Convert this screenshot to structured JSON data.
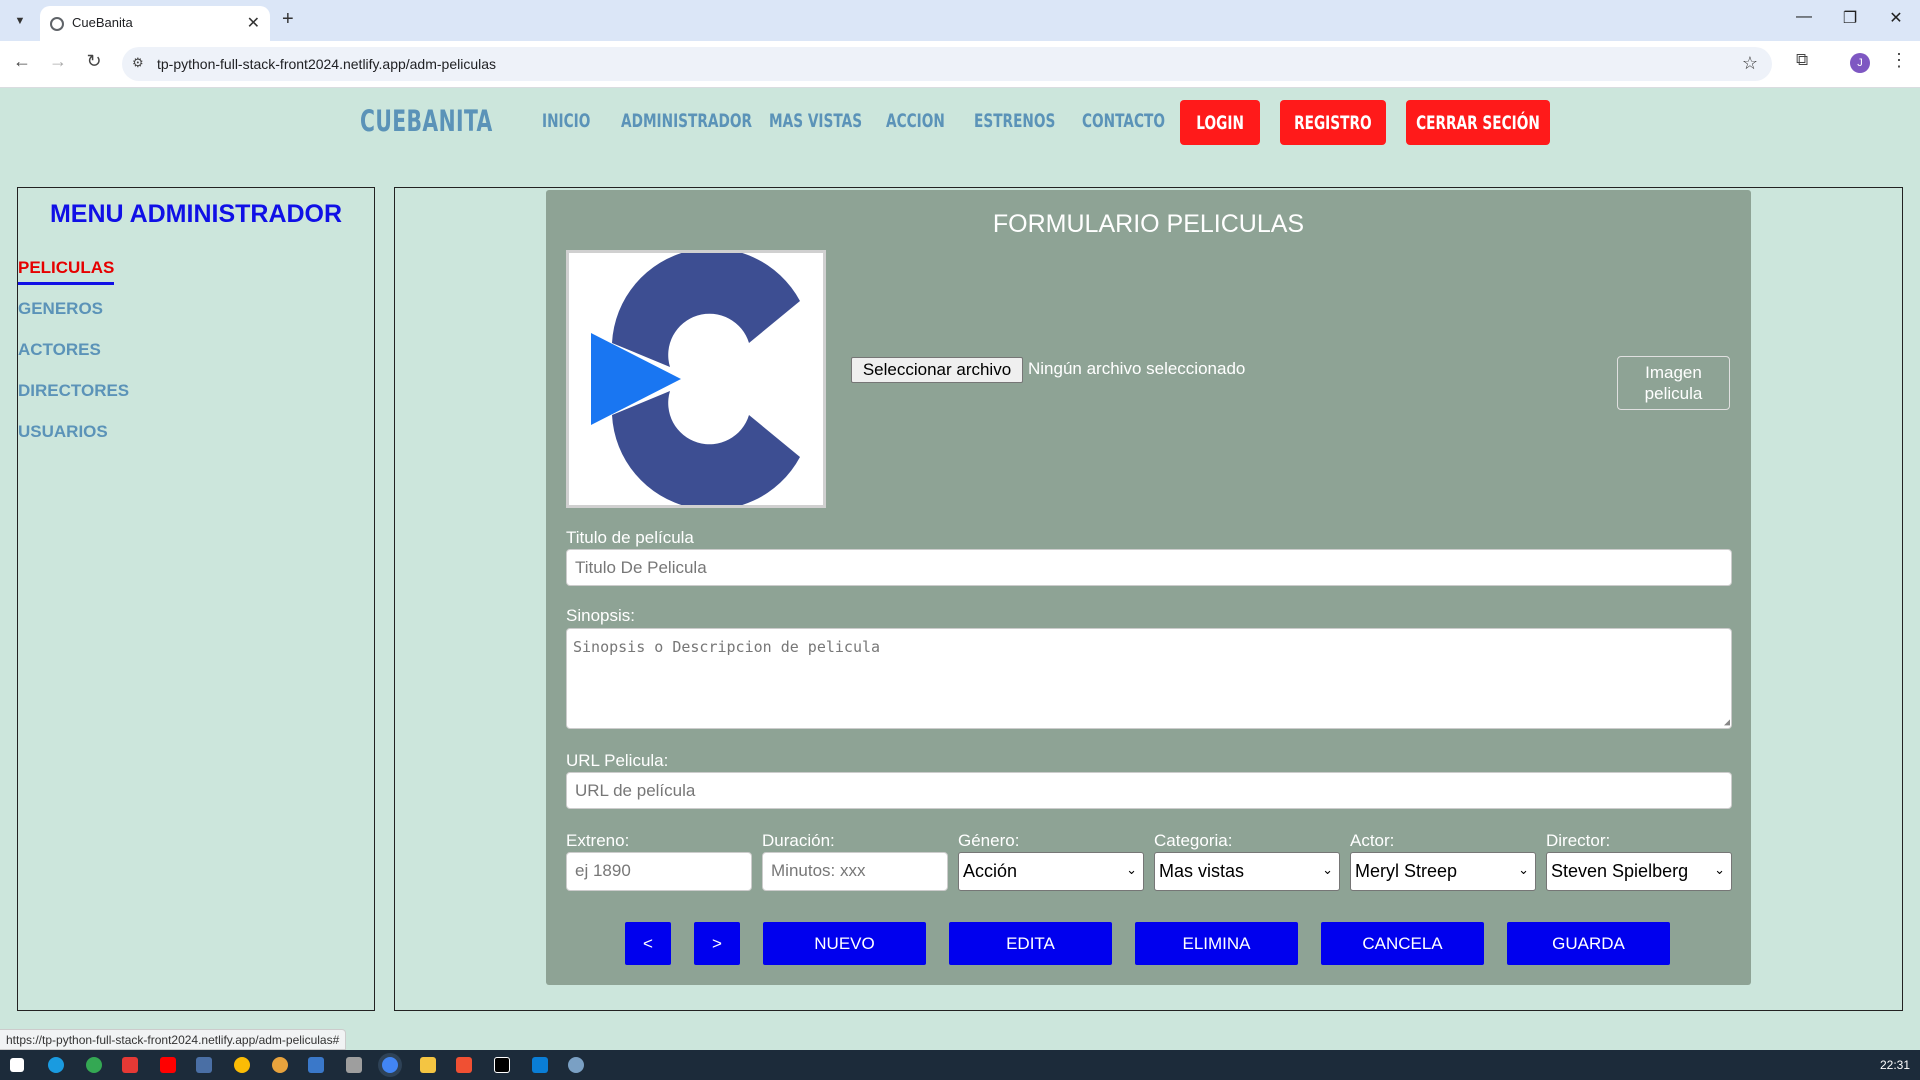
{
  "browser": {
    "tab_title": "CueBanita",
    "url": "tp-python-full-stack-front2024.netlify.app/adm-peliculas",
    "profile_initial": "J",
    "status_url": "https://tp-python-full-stack-front2024.netlify.app/adm-peliculas#"
  },
  "site": {
    "logo": "CUEBANITA",
    "nav": [
      "INICIO",
      "ADMINISTRADOR",
      "MAS VISTAS",
      "ACCION",
      "ESTRENOS",
      "CONTACTO"
    ],
    "buttons": {
      "login": "LOGIN",
      "registro": "REGISTRO",
      "logout": "CERRAR SECIÓN"
    }
  },
  "sidebar": {
    "title": "MENU ADMINISTRADOR",
    "items": [
      "PELICULAS",
      "GENEROS",
      "ACTORES",
      "DIRECTORES",
      "USUARIOS"
    ],
    "active": "PELICULAS"
  },
  "form": {
    "title": "FORMULARIO PELICULAS",
    "file_button": "Seleccionar archivo",
    "file_status": "Ningún archivo seleccionado",
    "image_label": "Imagen pelicula",
    "title_label": "Titulo de película",
    "title_placeholder": "Titulo De Pelicula",
    "synopsis_label": "Sinopsis:",
    "synopsis_placeholder": "Sinopsis o Descripcion de pelicula",
    "url_label": "URL Pelicula:",
    "url_placeholder": "URL de película",
    "release_label": "Extreno:",
    "release_placeholder": "ej 1890",
    "duration_label": "Duración:",
    "duration_placeholder": "Minutos: xxx",
    "genre_label": "Género:",
    "genre_value": "Acción",
    "category_label": "Categoria:",
    "category_value": "Mas vistas",
    "actor_label": "Actor:",
    "actor_value": "Meryl Streep",
    "director_label": "Director:",
    "director_value": "Steven Spielberg",
    "actions": {
      "prev": "<",
      "next": ">",
      "new": "NUEVO",
      "edit": "EDITA",
      "delete": "ELIMINA",
      "cancel": "CANCELA",
      "save": "GUARDA"
    }
  },
  "taskbar": {
    "clock": "22:31"
  },
  "colors": {
    "page_bg": "#cce6dc",
    "panel_bg": "#8ea395",
    "nav_text": "#5b93b8",
    "red_btn": "#ff1a1a",
    "blue_btn": "#0000ee",
    "sidebar_title": "#1010e6",
    "active_item": "#e60000"
  }
}
